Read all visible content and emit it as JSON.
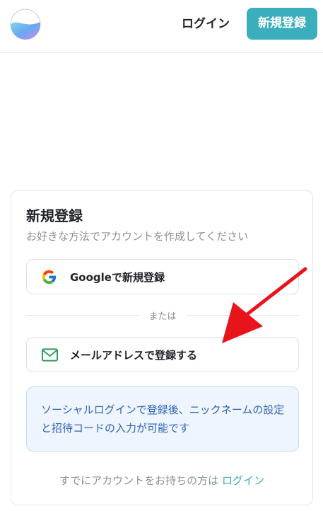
{
  "header": {
    "logo": "app-logo",
    "login_label": "ログイン",
    "signup_label": "新規登録"
  },
  "card": {
    "title": "新規登録",
    "subtitle": "お好きな方法でアカウントを作成してください",
    "google_button_label": "Googleで新規登録",
    "divider_text": "または",
    "email_button_label": "メールアドレスで登録する",
    "info_text": "ソーシャルログインで登録後、ニックネームの設定と招待コードの入力が可能です",
    "footer_prefix": "すでにアカウントをお持ちの方は",
    "footer_login_label": "ログイン"
  },
  "colors": {
    "accent": "#3aaebc",
    "info_text": "#2e64b5",
    "info_bg": "#eef5fe",
    "arrow": "#e8141c"
  },
  "icons": {
    "google": "google-icon",
    "mail": "mail-icon",
    "arrow": "red-arrow-annotation"
  }
}
